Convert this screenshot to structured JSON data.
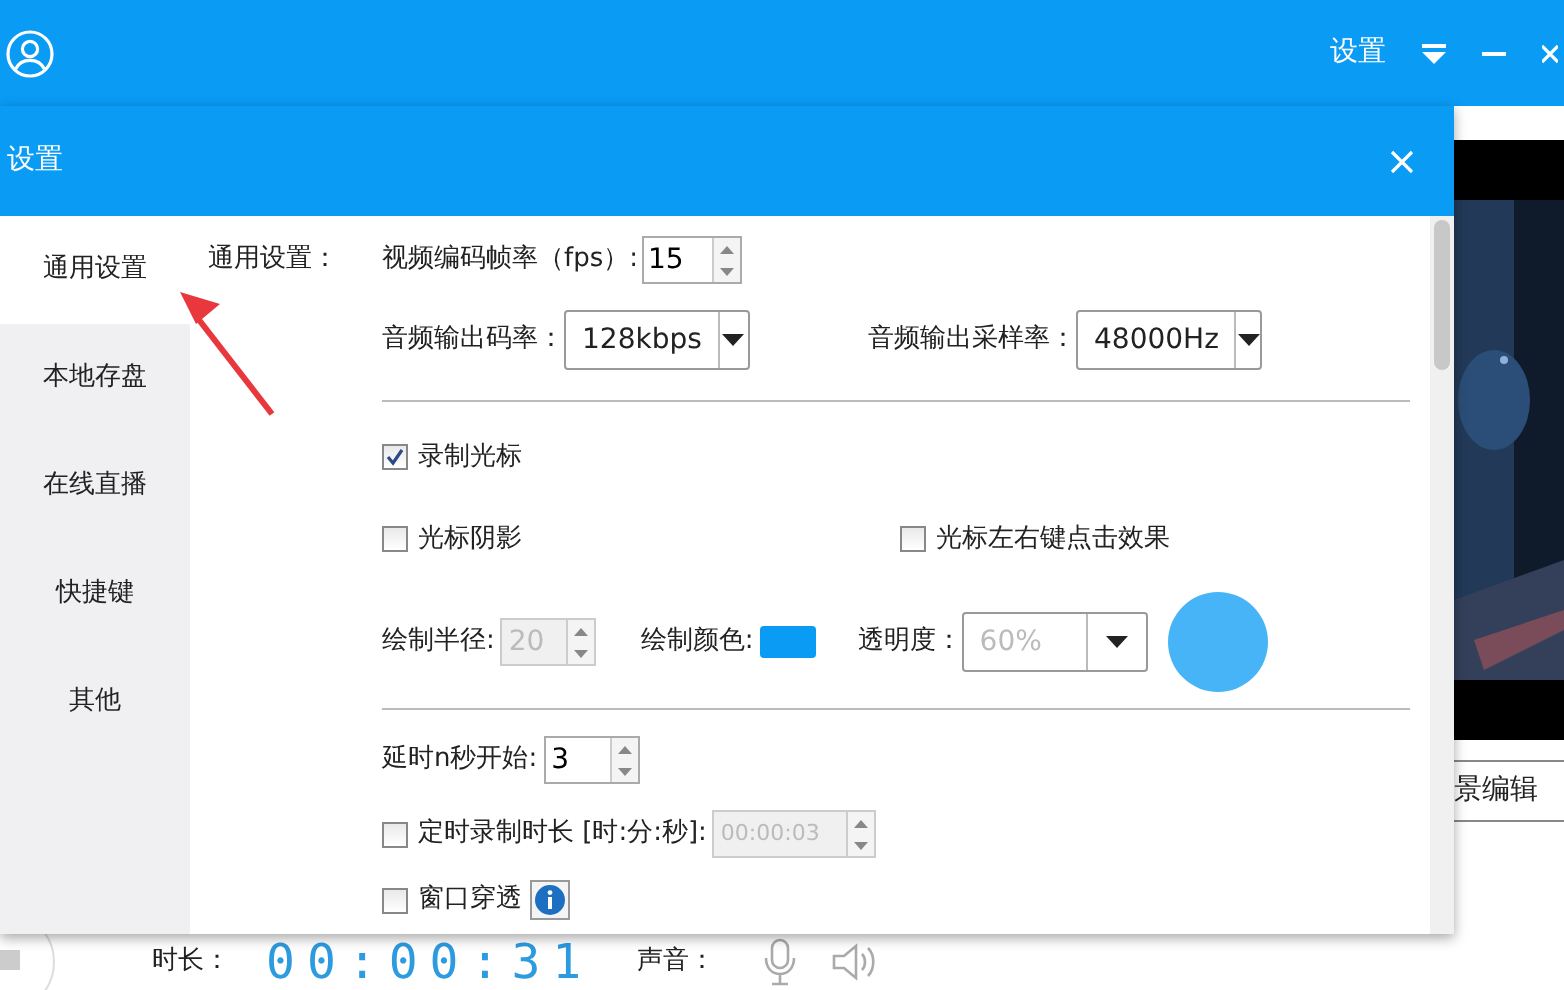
{
  "app": {
    "settings_label": "设置",
    "scene_edit": "景编辑",
    "duration_label": "时长：",
    "duration": "00:00:31",
    "sound_label": "声音："
  },
  "dialog": {
    "title": "设置",
    "nav": [
      {
        "label": "通用设置",
        "selected": true
      },
      {
        "label": "本地存盘",
        "selected": false
      },
      {
        "label": "在线直播",
        "selected": false
      },
      {
        "label": "快捷键",
        "selected": false
      },
      {
        "label": "其他",
        "selected": false
      }
    ],
    "section_label": "通用设置：",
    "fps": {
      "label": "视频编码帧率（fps）:",
      "value": "15"
    },
    "audio_bitrate": {
      "label": "音频输出码率：",
      "value": "128kbps"
    },
    "sample_rate": {
      "label": "音频输出采样率：",
      "value": "48000Hz"
    },
    "record_cursor": {
      "label": "录制光标",
      "checked": true
    },
    "cursor_shadow": {
      "label": "光标阴影",
      "checked": false
    },
    "click_effect": {
      "label": "光标左右键点击效果",
      "checked": false
    },
    "radius": {
      "label": "绘制半径:",
      "value": "20",
      "disabled": true
    },
    "draw_color": {
      "label": "绘制颜色:",
      "color": "#0a9bf5"
    },
    "opacity": {
      "label": "透明度：",
      "value": "60%",
      "disabled": true
    },
    "delay": {
      "label": "延时n秒开始:",
      "value": "3",
      "disabled": false
    },
    "timer": {
      "label": "定时录制时长 [时:分:秒]:",
      "checked": false,
      "value": "00:00:03",
      "disabled": true
    },
    "click_through": {
      "label": "窗口穿透",
      "checked": false
    }
  }
}
